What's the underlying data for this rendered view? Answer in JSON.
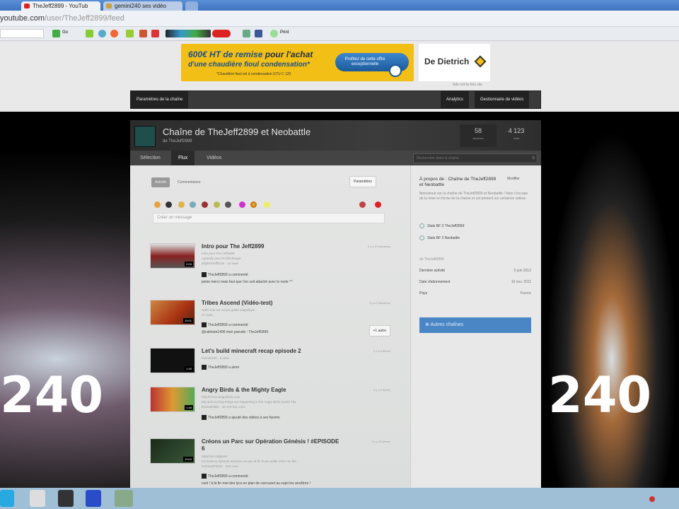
{
  "browser": {
    "tabs": [
      {
        "label": "TheJeff2899 - YouTub",
        "active": true
      },
      {
        "label": "gemini240 ses vidéo",
        "active": false
      }
    ],
    "url_host": "youtube.com",
    "url_path": "/user/TheJeff2899/feed",
    "bookmarks": {
      "go_label": "Go",
      "print_label": "Print"
    }
  },
  "ad": {
    "line1_bold": "600€ HT de remise",
    "line1_rest": " pour l'achat",
    "line2": "d'une chaudière fioul condensation*",
    "footnote": "*Chaudière fioul sol à condensation GTU C 120",
    "cta": "Profitez de cette offre exceptionnelle",
    "brand": "De Dietrich",
    "label": "Ads not by this site"
  },
  "owner_bar": {
    "settings": "Paramètres de la chaîne",
    "analytics": "Analytics",
    "video_manager": "Gestionnaire de vidéos"
  },
  "channel": {
    "title": "Chaîne de TheJeff2899 et Neobattle",
    "subtitle": "de TheJeff2899",
    "stats": [
      {
        "value": "58",
        "label": "abonnés"
      },
      {
        "value": "4 123",
        "label": "vues"
      }
    ],
    "tabs": [
      "Sélection",
      "Flux",
      "Vidéos"
    ],
    "active_tab": "Flux",
    "search_placeholder": "Rechercher dans la chaîne"
  },
  "feed": {
    "filter_active": "Activité",
    "filter_other": "Commentaires",
    "settings": "Paramètres",
    "message_placeholder": "Créer un message",
    "items": [
      {
        "title": "Intro pour The Jeff2899",
        "meta": [
          "Intro pour The Jeff2899",
          "Agrandir pour le télécharger",
          "playlist/JeffScan · 14 vues"
        ],
        "duration": "0:05",
        "ago": "il y a 10 semaines",
        "action": "TheJeff2899 a commenté",
        "comment": "jamie merci mais faut que l'on soit attaché avec le reste ^^"
      },
      {
        "title": "Tribes Ascend (Vidéo-test)",
        "meta": [
          "vidéo test sur un jeu gratis magnifique",
          "47 vues"
        ],
        "duration": "10:01",
        "ago": "il y a 9 semaines",
        "action": "TheJeff2899 a commenté",
        "comment": "@calinote1400 mon pseudo : TheJeff2899",
        "more": "+1 autre"
      },
      {
        "title": "Let's build minecraft recap episode 2",
        "meta": [
          "Gemini240 · 6 vues"
        ],
        "duration": "1:40",
        "ago": "il y a 5 février",
        "action": "TheJeff2899 a aimé",
        "comment": ""
      },
      {
        "title": "Angry Birds & the Mighty Eagle",
        "meta": [
          "http://e-ime.angrybirds.com",
          "Big and exciting things are happening in the Angry Birds world! The",
          "RovioMobile · 39 275 511 vues"
        ],
        "duration": "1:48",
        "ago": "il y a 5 février",
        "action": "TheJeff2899 a ajouté des vidéos à ses favoris",
        "comment": ""
      },
      {
        "title": "Créons un Parc sur Opération Génésis ! #EPISODE 6",
        "meta": [
          "Salut les indignes!",
          "Ce sixième épisode annonce un peu la fin d'une petite série me fait",
          "zertienal75014 · 345 vues"
        ],
        "duration": "10:04",
        "ago": "il y a 28 février",
        "action": "TheJeff2899 a commenté",
        "comment": "cool ! à la fin met des lycs en plan de carrousel au sujet les ancêtres !"
      }
    ]
  },
  "about": {
    "title": "À propos de : Chaîne de TheJeff2899 et Neobattle",
    "edit": "Modifier",
    "description": "Bienvenue sur la chaîne de TheJeff2899 et Neobattle ! Nais s'occupe de la mise en forme de la chaîne et est présent sur certaines vidéos",
    "links": [
      "Stats BF 3 TheJeff2899",
      "Stats BF 3 Neobattle"
    ],
    "by": "de TheJeff2899",
    "rows": [
      {
        "label": "Dernière activité",
        "value": "5 juin 2012"
      },
      {
        "label": "Date d'abonnement",
        "value": "16 nov. 2011"
      },
      {
        "label": "Pays",
        "value": "France"
      }
    ],
    "other_channels": "Autres chaînes"
  }
}
